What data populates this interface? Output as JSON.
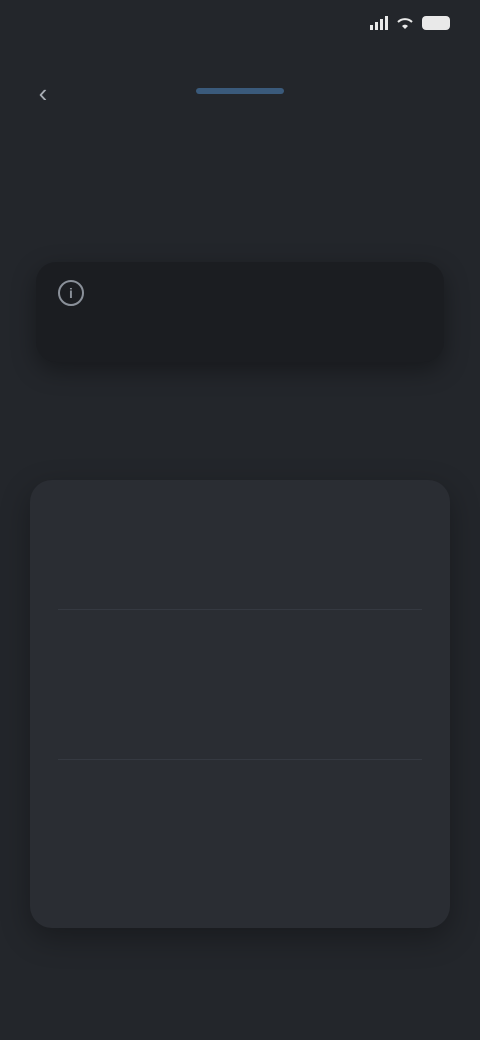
{
  "status_bar": {
    "time": "",
    "icons": [
      "signal-icon",
      "wifi-icon",
      "battery-icon"
    ]
  },
  "nav": {
    "back_icon": "chevron-left-icon",
    "brand": ""
  },
  "heading": {
    "title": ""
  },
  "info": {
    "icon": "info-icon",
    "text": ""
  },
  "options": [
    {
      "title": "",
      "description": ""
    },
    {
      "title": "",
      "description": ""
    },
    {
      "title": "",
      "description": ""
    }
  ],
  "colors": {
    "background": "#23262b",
    "card": "#1b1d21",
    "panel": "#2a2d33",
    "accent": "#3a5a7b"
  }
}
